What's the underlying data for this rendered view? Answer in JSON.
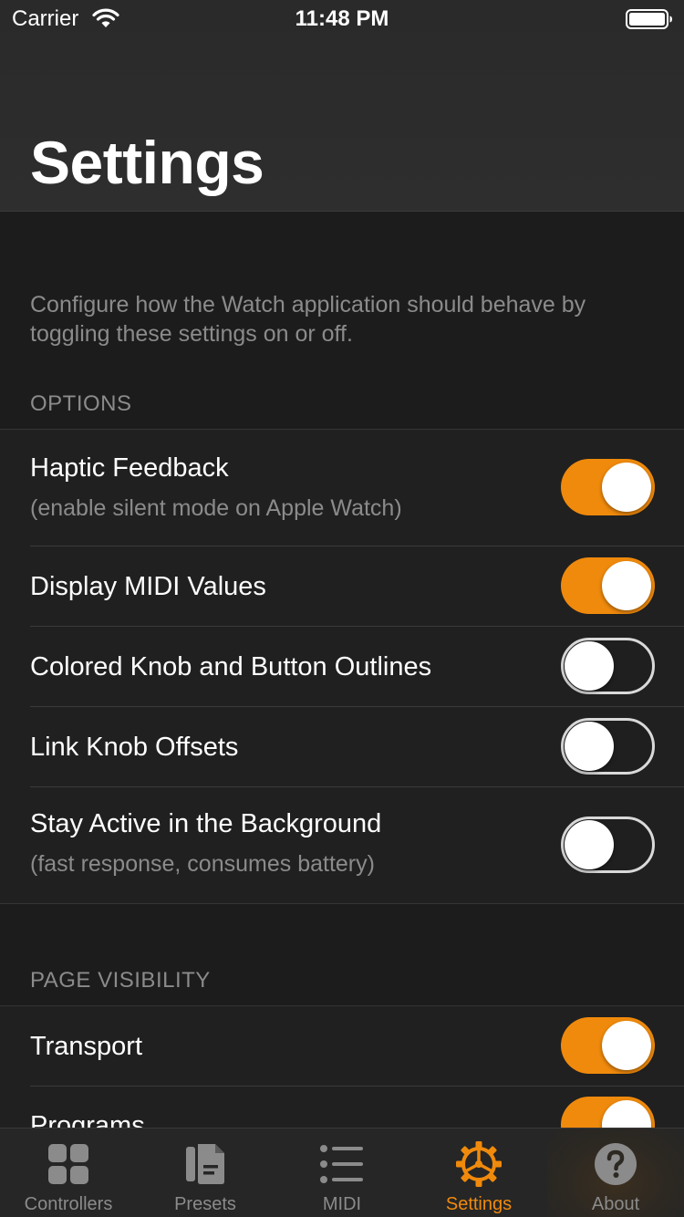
{
  "status_bar": {
    "carrier": "Carrier",
    "time": "11:48 PM"
  },
  "header": {
    "title": "Settings"
  },
  "intro_text": "Configure how the Watch application should behave by toggling these settings on or off.",
  "sections": [
    {
      "header": "OPTIONS",
      "rows": [
        {
          "title": "Haptic Feedback",
          "subtitle": "(enable silent mode on Apple Watch)",
          "on": true
        },
        {
          "title": "Display MIDI Values",
          "subtitle": "",
          "on": true
        },
        {
          "title": "Colored Knob and Button Outlines",
          "subtitle": "",
          "on": false
        },
        {
          "title": "Link Knob Offsets",
          "subtitle": "",
          "on": false
        },
        {
          "title": "Stay Active in the Background",
          "subtitle": "(fast response, consumes battery)",
          "on": false
        }
      ]
    },
    {
      "header": "PAGE VISIBILITY",
      "rows": [
        {
          "title": "Transport",
          "subtitle": "",
          "on": true
        },
        {
          "title": "Programs",
          "subtitle": "",
          "on": true
        }
      ]
    }
  ],
  "tabs": [
    {
      "label": "Controllers",
      "icon": "grid-icon",
      "active": false
    },
    {
      "label": "Presets",
      "icon": "document-icon",
      "active": false
    },
    {
      "label": "MIDI",
      "icon": "list-icon",
      "active": false
    },
    {
      "label": "Settings",
      "icon": "gear-icon",
      "active": true
    },
    {
      "label": "About",
      "icon": "question-icon",
      "active": false
    }
  ],
  "colors": {
    "accent": "#f08a0c",
    "background": "#1c1c1c",
    "header": "#2e2e2e",
    "secondary_text": "#8b8b8b"
  }
}
